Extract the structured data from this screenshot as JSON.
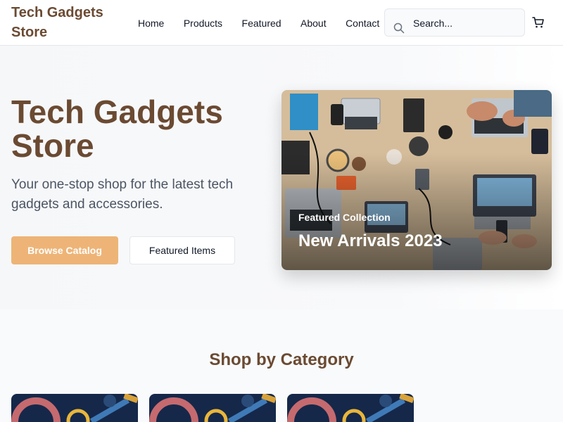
{
  "header": {
    "brand": "Tech Gadgets Store",
    "nav": [
      "Home",
      "Products",
      "Featured",
      "About",
      "Contact"
    ],
    "search_placeholder": "Search...",
    "cart_icon": "cart-icon",
    "search_icon": "search-icon"
  },
  "hero": {
    "title": "Tech Gadgets Store",
    "subtitle": "Your one-stop shop for the latest tech gadgets and accessories.",
    "primary_button": "Browse Catalog",
    "secondary_button": "Featured Items",
    "feature": {
      "kicker": "Featured Collection",
      "title": "New Arrivals 2023"
    }
  },
  "categories": {
    "heading": "Shop by Category"
  },
  "colors": {
    "brand": "#6b4a32",
    "accent": "#eeb477",
    "text_muted": "#4b5563"
  }
}
